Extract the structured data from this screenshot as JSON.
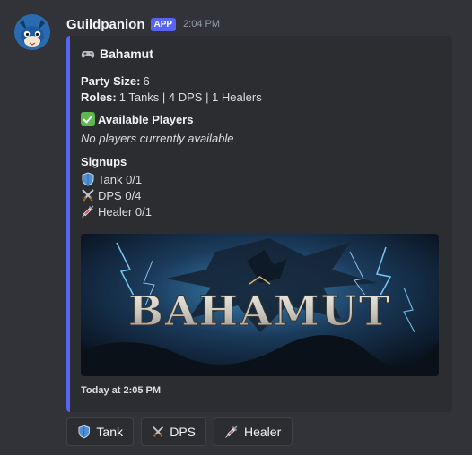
{
  "message": {
    "username": "Guildpanion",
    "badge": "APP",
    "time": "2:04 PM"
  },
  "embed": {
    "title": "Bahamut",
    "title_icon": "gamepad-icon",
    "accent_color": "#5865f2",
    "party_size_label": "Party Size:",
    "party_size_value": "6",
    "roles_label": "Roles:",
    "roles_value": "1 Tanks | 4 DPS | 1 Healers",
    "available_heading": "Available Players",
    "available_text": "No players currently available",
    "signups_heading": "Signups",
    "signups": [
      {
        "icon": "shield-icon",
        "text": "Tank 0/1"
      },
      {
        "icon": "crossed-swords-icon",
        "text": "DPS 0/4"
      },
      {
        "icon": "syringe-icon",
        "text": "Healer 0/1"
      }
    ],
    "image_text": "BAHAMUT",
    "footer": "Today at 2:05 PM"
  },
  "buttons": [
    {
      "icon": "shield-icon",
      "label": "Tank"
    },
    {
      "icon": "crossed-swords-icon",
      "label": "DPS"
    },
    {
      "icon": "syringe-icon",
      "label": "Healer"
    }
  ]
}
